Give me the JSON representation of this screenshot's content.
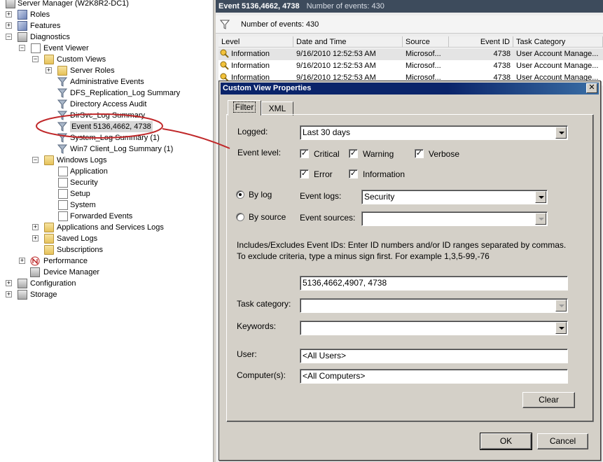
{
  "tree": {
    "items": [
      {
        "label": "Server Manager (W2K8R2-DC1)",
        "icon": "server-icon",
        "expander": ""
      },
      {
        "label": "Roles",
        "icon": "roles-icon",
        "expander": "+"
      },
      {
        "label": "Features",
        "icon": "features-icon",
        "expander": "+"
      },
      {
        "label": "Diagnostics",
        "icon": "diagnostics-icon",
        "expander": "−"
      },
      {
        "label": "Event Viewer",
        "icon": "event-viewer-icon",
        "expander": "−"
      },
      {
        "label": "Custom Views",
        "icon": "folder-icon",
        "expander": "−"
      },
      {
        "label": "Server Roles",
        "icon": "folder-icon",
        "expander": "+"
      },
      {
        "label": "Administrative Events",
        "icon": "filter-icon",
        "expander": ""
      },
      {
        "label": "DFS_Replication_Log Summary",
        "icon": "filter-icon",
        "expander": ""
      },
      {
        "label": "Directory Access Audit",
        "icon": "filter-icon",
        "expander": ""
      },
      {
        "label": "DirSvc_Log Summary",
        "icon": "filter-icon",
        "expander": ""
      },
      {
        "label": "Event 5136,4662, 4738",
        "icon": "filter-icon",
        "expander": ""
      },
      {
        "label": "System_Log Summary (1)",
        "icon": "filter-icon",
        "expander": ""
      },
      {
        "label": "Win7 Client_Log Summary (1)",
        "icon": "filter-icon",
        "expander": ""
      },
      {
        "label": "Windows Logs",
        "icon": "folder-icon",
        "expander": "−"
      },
      {
        "label": "Application",
        "icon": "log-icon",
        "expander": ""
      },
      {
        "label": "Security",
        "icon": "log-icon",
        "expander": ""
      },
      {
        "label": "Setup",
        "icon": "log-icon",
        "expander": ""
      },
      {
        "label": "System",
        "icon": "log-icon",
        "expander": ""
      },
      {
        "label": "Forwarded Events",
        "icon": "log-icon",
        "expander": ""
      },
      {
        "label": "Applications and Services Logs",
        "icon": "folder-icon",
        "expander": "+"
      },
      {
        "label": "Saved Logs",
        "icon": "folder-icon",
        "expander": "+"
      },
      {
        "label": "Subscriptions",
        "icon": "subscriptions-icon",
        "expander": ""
      },
      {
        "label": "Performance",
        "icon": "performance-icon",
        "expander": "+"
      },
      {
        "label": "Device Manager",
        "icon": "device-manager-icon",
        "expander": ""
      },
      {
        "label": "Configuration",
        "icon": "configuration-icon",
        "expander": "+"
      },
      {
        "label": "Storage",
        "icon": "storage-icon",
        "expander": "+"
      }
    ]
  },
  "right": {
    "header_title": "Event 5136,4662, 4738",
    "header_sub": "Number of events: 430",
    "filter_text": "Number of events: 430",
    "columns": [
      "Level",
      "Date and Time",
      "Source",
      "Event ID",
      "Task Category"
    ],
    "rows": [
      {
        "level": "Information",
        "date": "9/16/2010 12:52:53 AM",
        "source": "Microsof...",
        "event_id": "4738",
        "task": "User Account Manage..."
      },
      {
        "level": "Information",
        "date": "9/16/2010 12:52:53 AM",
        "source": "Microsof...",
        "event_id": "4738",
        "task": "User Account Manage..."
      },
      {
        "level": "Information",
        "date": "9/16/2010 12:52:53 AM",
        "source": "Microsof...",
        "event_id": "4738",
        "task": "User Account Manage..."
      }
    ]
  },
  "dialog": {
    "title": "Custom View Properties",
    "close": "✕",
    "tabs": [
      "Filter",
      "XML"
    ],
    "logged_label": "Logged:",
    "logged_value": "Last 30 days",
    "event_level_label": "Event level:",
    "levels": {
      "critical": "Critical",
      "warning": "Warning",
      "verbose": "Verbose",
      "error": "Error",
      "information": "Information"
    },
    "check_mark": "✓",
    "by_log": "By log",
    "by_source": "By source",
    "event_logs_label": "Event logs:",
    "event_logs_value": "Security",
    "event_sources_label": "Event sources:",
    "event_sources_value": "",
    "include_note": "Includes/Excludes Event IDs: Enter ID numbers and/or ID ranges separated by commas. To exclude criteria, type a minus sign first. For example 1,3,5-99,-76",
    "event_ids_value": "5136,4662,4907, 4738",
    "task_category_label": "Task category:",
    "keywords_label": "Keywords:",
    "user_label": "User:",
    "user_value": "<All Users>",
    "computers_label": "Computer(s):",
    "computers_value": "<All Computers>",
    "clear": "Clear",
    "ok": "OK",
    "cancel": "Cancel"
  },
  "colors": {
    "title_bar": "#0a246a",
    "right_header": "#3d4b5c",
    "annotation": "#c0282a"
  }
}
